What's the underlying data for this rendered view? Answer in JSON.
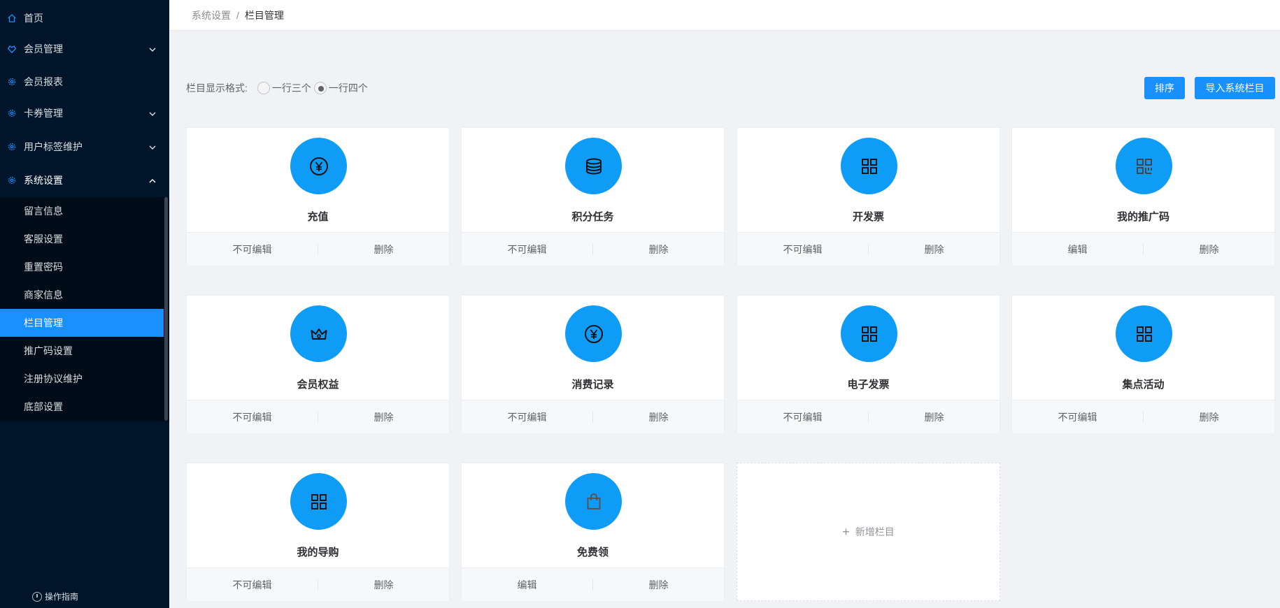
{
  "colors": {
    "sidebar_bg": "#001529",
    "accent": "#1890ff",
    "icon_circle": "#0e9cf6"
  },
  "sidebar": {
    "menu": [
      {
        "label": "首页",
        "icon": "home-icon",
        "expandable": false
      },
      {
        "label": "会员管理",
        "icon": "heart-icon",
        "expandable": true
      },
      {
        "label": "会员报表",
        "icon": "gear-icon",
        "expandable": false
      },
      {
        "label": "卡券管理",
        "icon": "gear-icon",
        "expandable": true
      },
      {
        "label": "用户标签维护",
        "icon": "gear-icon",
        "expandable": true
      },
      {
        "label": "系统设置",
        "icon": "gear-icon",
        "expandable": true,
        "expanded": true
      }
    ],
    "submenu": [
      {
        "label": "留言信息"
      },
      {
        "label": "客服设置"
      },
      {
        "label": "重置密码"
      },
      {
        "label": "商家信息"
      },
      {
        "label": "栏目管理",
        "active": true
      },
      {
        "label": "推广码设置"
      },
      {
        "label": "注册协议维护"
      },
      {
        "label": "底部设置"
      }
    ],
    "guide_label": "操作指南"
  },
  "breadcrumb": {
    "parent": "系统设置",
    "separator": "/",
    "current": "栏目管理"
  },
  "format": {
    "label": "栏目显示格式:",
    "options": [
      {
        "label": "一行三个",
        "checked": false
      },
      {
        "label": "一行四个",
        "checked": true
      }
    ]
  },
  "buttons": {
    "sort": "排序",
    "import": "导入系统栏目"
  },
  "cards": [
    {
      "title": "充值",
      "icon": "yen-icon",
      "left_action": "不可编辑",
      "right_action": "删除"
    },
    {
      "title": "积分任务",
      "icon": "database-icon",
      "left_action": "不可编辑",
      "right_action": "删除"
    },
    {
      "title": "开发票",
      "icon": "grid-icon",
      "left_action": "不可编辑",
      "right_action": "删除"
    },
    {
      "title": "我的推广码",
      "icon": "qrcode-icon",
      "left_action": "编辑",
      "right_action": "删除"
    },
    {
      "title": "会员权益",
      "icon": "crown-icon",
      "left_action": "不可编辑",
      "right_action": "删除"
    },
    {
      "title": "消费记录",
      "icon": "yen-icon",
      "left_action": "不可编辑",
      "right_action": "删除"
    },
    {
      "title": "电子发票",
      "icon": "grid-icon",
      "left_action": "不可编辑",
      "right_action": "删除"
    },
    {
      "title": "集点活动",
      "icon": "grid-icon",
      "left_action": "不可编辑",
      "right_action": "删除"
    },
    {
      "title": "我的导购",
      "icon": "grid-icon",
      "left_action": "不可编辑",
      "right_action": "删除"
    },
    {
      "title": "免费领",
      "icon": "bag-icon",
      "left_action": "编辑",
      "right_action": "删除"
    }
  ],
  "add_card": {
    "plus": "+",
    "label": "新增栏目"
  }
}
